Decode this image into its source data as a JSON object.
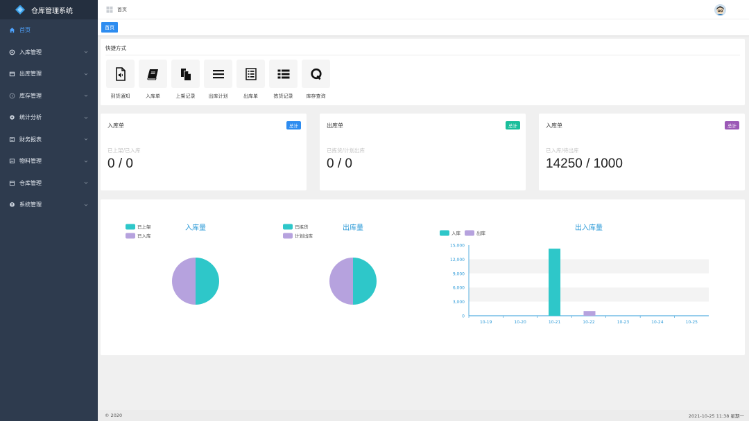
{
  "app": {
    "title": "仓库管理系统"
  },
  "sidebar": {
    "items": [
      {
        "label": "首页",
        "icon": "home-icon",
        "active": true
      },
      {
        "label": "入库管理",
        "icon": "circle-icon"
      },
      {
        "label": "出库管理",
        "icon": "box-icon"
      },
      {
        "label": "库存管理",
        "icon": "clock-icon"
      },
      {
        "label": "统计分析",
        "icon": "gear-icon"
      },
      {
        "label": "财务报表",
        "icon": "list-icon"
      },
      {
        "label": "物料管理",
        "icon": "image-icon"
      },
      {
        "label": "仓库管理",
        "icon": "calendar-icon"
      },
      {
        "label": "系统管理",
        "icon": "user-icon"
      }
    ]
  },
  "topbar": {
    "breadcrumb": "首页"
  },
  "tabs": [
    {
      "label": "首页"
    }
  ],
  "quick": {
    "title": "快捷方式",
    "items": [
      {
        "label": "到货通知",
        "icon": "audio-file-icon"
      },
      {
        "label": "入库单",
        "icon": "book-icon"
      },
      {
        "label": "上架记录",
        "icon": "copy-icon"
      },
      {
        "label": "出库计划",
        "icon": "menu-lines-icon"
      },
      {
        "label": "出库单",
        "icon": "list-doc-icon"
      },
      {
        "label": "拣货记录",
        "icon": "list-bullets-icon"
      },
      {
        "label": "库存查询",
        "icon": "q-letter-icon"
      }
    ]
  },
  "stats": [
    {
      "title": "入库单",
      "badge": "总计",
      "badge_color": "#2d8cf0",
      "subtitle": "已上架/已入库",
      "value": "0 / 0"
    },
    {
      "title": "出库单",
      "badge": "总计",
      "badge_color": "#19be9b",
      "subtitle": "已拣货/计划出库",
      "value": "0 / 0"
    },
    {
      "title": "入库单",
      "badge": "总计",
      "badge_color": "#9b59b6",
      "subtitle": "已入库/待出库",
      "value": "14250 / 1000"
    }
  ],
  "colors": {
    "teal": "#2ec7c9",
    "lavender": "#b6a2de",
    "accent": "#2d8cf0",
    "sidebar_bg": "#2e3b4e"
  },
  "chart_data": [
    {
      "type": "pie",
      "title": "入库量",
      "labels": [
        "已上架",
        "已入库"
      ],
      "values": [
        50,
        50
      ]
    },
    {
      "type": "pie",
      "title": "出库量",
      "labels": [
        "已拣货",
        "计划出库"
      ],
      "values": [
        50,
        50
      ]
    },
    {
      "type": "bar",
      "title": "出入库量",
      "categories": [
        "10-19",
        "10-20",
        "10-21",
        "10-22",
        "10-23",
        "10-24",
        "10-25"
      ],
      "series": [
        {
          "name": "入库",
          "values": [
            0,
            0,
            14250,
            0,
            0,
            0,
            0
          ]
        },
        {
          "name": "出库",
          "values": [
            0,
            0,
            0,
            1000,
            0,
            0,
            0
          ]
        }
      ],
      "ylim": [
        0,
        15000
      ],
      "yticks": [
        "0",
        "3,000",
        "6,000",
        "9,000",
        "12,000",
        "15,000"
      ]
    }
  ],
  "footer": {
    "left": "© 2020",
    "right": "2021-10-25 11:38 星期一"
  }
}
